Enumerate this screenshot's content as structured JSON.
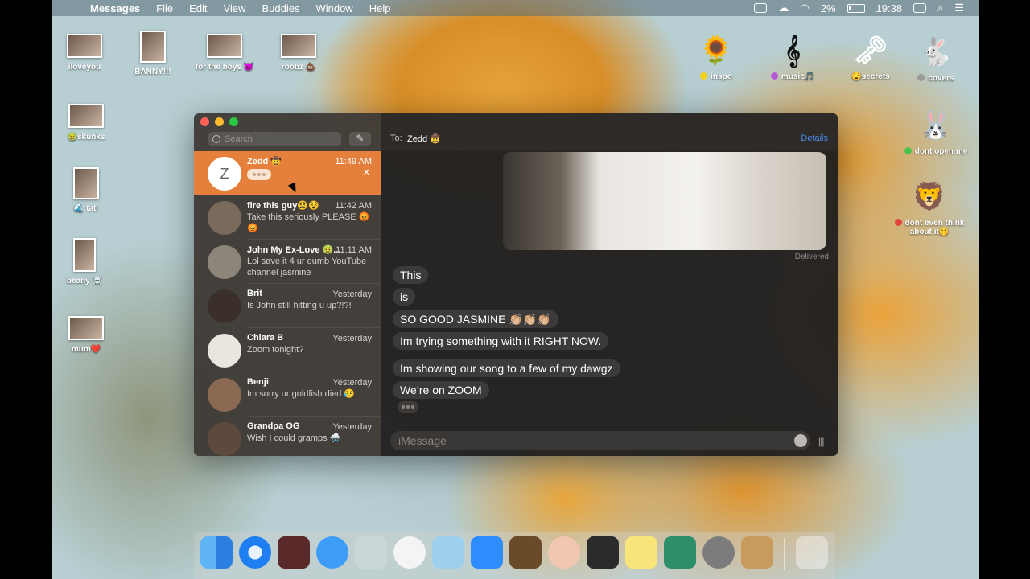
{
  "menubar": {
    "app_name": "Messages",
    "menus": [
      "File",
      "Edit",
      "View",
      "Buddies",
      "Window",
      "Help"
    ],
    "battery": "2%",
    "time": "19:38"
  },
  "desktop_icons": [
    {
      "label": "iloveyou"
    },
    {
      "label": "BANNY!!!"
    },
    {
      "label": "for the boys 😈"
    },
    {
      "label": "roobz 💩"
    },
    {
      "label": "🤢skunks"
    },
    {
      "label": "🌊 tati"
    },
    {
      "label": "beany ☠️"
    },
    {
      "label": "mum❤️"
    },
    {
      "label": "inspo",
      "glyph": "🌻",
      "dot_color": "#f2d21e"
    },
    {
      "label": "music🎵",
      "glyph": "𝄞",
      "dot_color": "#b25bd6"
    },
    {
      "label": "😧secrets",
      "glyph": "🗝"
    },
    {
      "label": "covers",
      "glyph": "🐇",
      "dot_color": "#9a9a9a"
    },
    {
      "label": "dont open me",
      "glyph": "🐰",
      "dot_color": "#4cc24c"
    },
    {
      "label": "dont even think about it🤫",
      "glyph": "🦁",
      "dot_color": "#e2433e"
    }
  ],
  "sidebar": {
    "search_placeholder": "Search",
    "conversations": [
      {
        "name": "Zedd 🤠",
        "time": "11:49 AM",
        "preview": "",
        "avatar_letter": "Z",
        "selected": true
      },
      {
        "name": "fire this guy😫😵",
        "time": "11:42 AM",
        "preview": "Take this seriously PLEASE 😡😡"
      },
      {
        "name": "John My Ex-Love 🤢...",
        "time": "11:11 AM",
        "preview": "Lol save it 4 ur dumb YouTube channel jasmine"
      },
      {
        "name": "Brit",
        "time": "Yesterday",
        "preview": "Is John still hitting u up?!?!"
      },
      {
        "name": "Chiara B",
        "time": "Yesterday",
        "preview": "Zoom tonight?"
      },
      {
        "name": "Benji",
        "time": "Yesterday",
        "preview": "Im sorry ur goldfish died 😥"
      },
      {
        "name": "Grandpa OG",
        "time": "Yesterday",
        "preview": "Wish I could gramps 🌧️"
      }
    ]
  },
  "chat": {
    "to_label": "To:",
    "to_name": "Zedd 🤠",
    "details_label": "Details",
    "delivered": "Delivered",
    "messages": [
      "This",
      "is",
      "SO GOOD JASMINE 👏🏼👏🏼👏🏼",
      "Im trying something with it RIGHT NOW.",
      "Im showing our song to a few of my dawgz",
      "We’re on ZOOM"
    ],
    "input_placeholder": "iMessage"
  }
}
